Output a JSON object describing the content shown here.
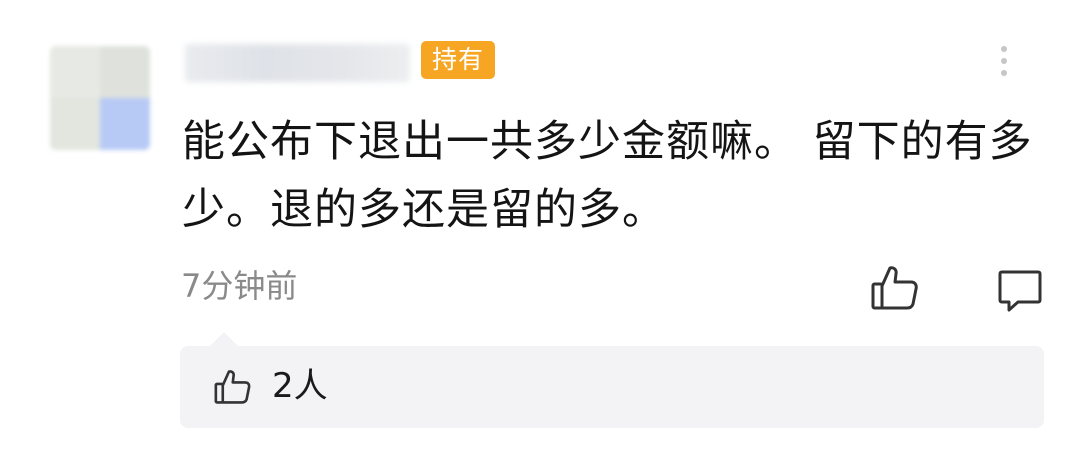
{
  "comment": {
    "badge_label": "持有",
    "text": "能公布下退出一共多少金额嘛。 留下的有多少。退的多还是留的多。",
    "timestamp": "7分钟前"
  },
  "likes": {
    "count_label": "2人"
  },
  "icons": {
    "more": "more-vertical-icon",
    "like": "thumbs-up-icon",
    "reply": "comment-icon",
    "likes_summary": "thumbs-up-icon"
  },
  "colors": {
    "badge_bg": "#f6a623",
    "text": "#141414",
    "meta": "#8a8a8a",
    "icon": "#333333",
    "panel_bg": "#f3f3f5",
    "more_dots": "#c6c6c6"
  }
}
